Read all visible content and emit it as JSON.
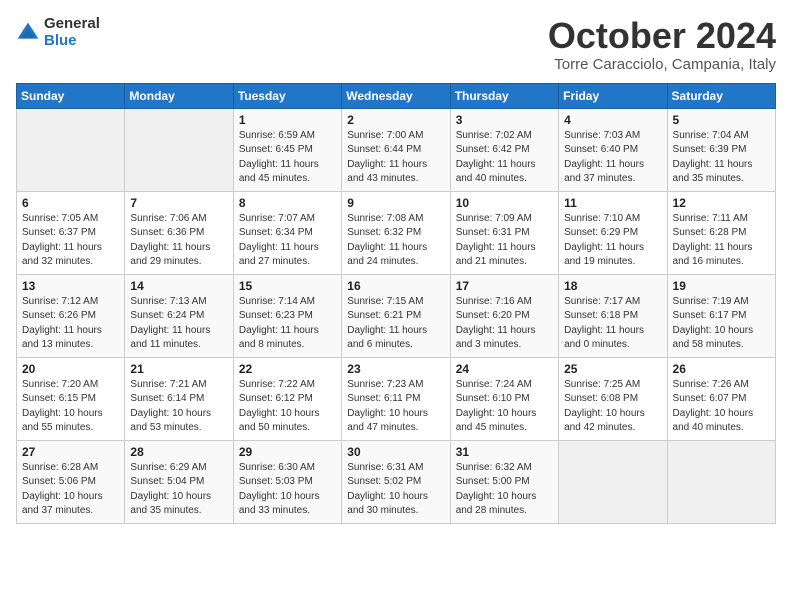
{
  "logo": {
    "general": "General",
    "blue": "Blue"
  },
  "title": "October 2024",
  "location": "Torre Caracciolo, Campania, Italy",
  "weekdays": [
    "Sunday",
    "Monday",
    "Tuesday",
    "Wednesday",
    "Thursday",
    "Friday",
    "Saturday"
  ],
  "weeks": [
    [
      {
        "day": "",
        "sunrise": "",
        "sunset": "",
        "daylight": ""
      },
      {
        "day": "",
        "sunrise": "",
        "sunset": "",
        "daylight": ""
      },
      {
        "day": "1",
        "sunrise": "Sunrise: 6:59 AM",
        "sunset": "Sunset: 6:45 PM",
        "daylight": "Daylight: 11 hours and 45 minutes."
      },
      {
        "day": "2",
        "sunrise": "Sunrise: 7:00 AM",
        "sunset": "Sunset: 6:44 PM",
        "daylight": "Daylight: 11 hours and 43 minutes."
      },
      {
        "day": "3",
        "sunrise": "Sunrise: 7:02 AM",
        "sunset": "Sunset: 6:42 PM",
        "daylight": "Daylight: 11 hours and 40 minutes."
      },
      {
        "day": "4",
        "sunrise": "Sunrise: 7:03 AM",
        "sunset": "Sunset: 6:40 PM",
        "daylight": "Daylight: 11 hours and 37 minutes."
      },
      {
        "day": "5",
        "sunrise": "Sunrise: 7:04 AM",
        "sunset": "Sunset: 6:39 PM",
        "daylight": "Daylight: 11 hours and 35 minutes."
      }
    ],
    [
      {
        "day": "6",
        "sunrise": "Sunrise: 7:05 AM",
        "sunset": "Sunset: 6:37 PM",
        "daylight": "Daylight: 11 hours and 32 minutes."
      },
      {
        "day": "7",
        "sunrise": "Sunrise: 7:06 AM",
        "sunset": "Sunset: 6:36 PM",
        "daylight": "Daylight: 11 hours and 29 minutes."
      },
      {
        "day": "8",
        "sunrise": "Sunrise: 7:07 AM",
        "sunset": "Sunset: 6:34 PM",
        "daylight": "Daylight: 11 hours and 27 minutes."
      },
      {
        "day": "9",
        "sunrise": "Sunrise: 7:08 AM",
        "sunset": "Sunset: 6:32 PM",
        "daylight": "Daylight: 11 hours and 24 minutes."
      },
      {
        "day": "10",
        "sunrise": "Sunrise: 7:09 AM",
        "sunset": "Sunset: 6:31 PM",
        "daylight": "Daylight: 11 hours and 21 minutes."
      },
      {
        "day": "11",
        "sunrise": "Sunrise: 7:10 AM",
        "sunset": "Sunset: 6:29 PM",
        "daylight": "Daylight: 11 hours and 19 minutes."
      },
      {
        "day": "12",
        "sunrise": "Sunrise: 7:11 AM",
        "sunset": "Sunset: 6:28 PM",
        "daylight": "Daylight: 11 hours and 16 minutes."
      }
    ],
    [
      {
        "day": "13",
        "sunrise": "Sunrise: 7:12 AM",
        "sunset": "Sunset: 6:26 PM",
        "daylight": "Daylight: 11 hours and 13 minutes."
      },
      {
        "day": "14",
        "sunrise": "Sunrise: 7:13 AM",
        "sunset": "Sunset: 6:24 PM",
        "daylight": "Daylight: 11 hours and 11 minutes."
      },
      {
        "day": "15",
        "sunrise": "Sunrise: 7:14 AM",
        "sunset": "Sunset: 6:23 PM",
        "daylight": "Daylight: 11 hours and 8 minutes."
      },
      {
        "day": "16",
        "sunrise": "Sunrise: 7:15 AM",
        "sunset": "Sunset: 6:21 PM",
        "daylight": "Daylight: 11 hours and 6 minutes."
      },
      {
        "day": "17",
        "sunrise": "Sunrise: 7:16 AM",
        "sunset": "Sunset: 6:20 PM",
        "daylight": "Daylight: 11 hours and 3 minutes."
      },
      {
        "day": "18",
        "sunrise": "Sunrise: 7:17 AM",
        "sunset": "Sunset: 6:18 PM",
        "daylight": "Daylight: 11 hours and 0 minutes."
      },
      {
        "day": "19",
        "sunrise": "Sunrise: 7:19 AM",
        "sunset": "Sunset: 6:17 PM",
        "daylight": "Daylight: 10 hours and 58 minutes."
      }
    ],
    [
      {
        "day": "20",
        "sunrise": "Sunrise: 7:20 AM",
        "sunset": "Sunset: 6:15 PM",
        "daylight": "Daylight: 10 hours and 55 minutes."
      },
      {
        "day": "21",
        "sunrise": "Sunrise: 7:21 AM",
        "sunset": "Sunset: 6:14 PM",
        "daylight": "Daylight: 10 hours and 53 minutes."
      },
      {
        "day": "22",
        "sunrise": "Sunrise: 7:22 AM",
        "sunset": "Sunset: 6:12 PM",
        "daylight": "Daylight: 10 hours and 50 minutes."
      },
      {
        "day": "23",
        "sunrise": "Sunrise: 7:23 AM",
        "sunset": "Sunset: 6:11 PM",
        "daylight": "Daylight: 10 hours and 47 minutes."
      },
      {
        "day": "24",
        "sunrise": "Sunrise: 7:24 AM",
        "sunset": "Sunset: 6:10 PM",
        "daylight": "Daylight: 10 hours and 45 minutes."
      },
      {
        "day": "25",
        "sunrise": "Sunrise: 7:25 AM",
        "sunset": "Sunset: 6:08 PM",
        "daylight": "Daylight: 10 hours and 42 minutes."
      },
      {
        "day": "26",
        "sunrise": "Sunrise: 7:26 AM",
        "sunset": "Sunset: 6:07 PM",
        "daylight": "Daylight: 10 hours and 40 minutes."
      }
    ],
    [
      {
        "day": "27",
        "sunrise": "Sunrise: 6:28 AM",
        "sunset": "Sunset: 5:06 PM",
        "daylight": "Daylight: 10 hours and 37 minutes."
      },
      {
        "day": "28",
        "sunrise": "Sunrise: 6:29 AM",
        "sunset": "Sunset: 5:04 PM",
        "daylight": "Daylight: 10 hours and 35 minutes."
      },
      {
        "day": "29",
        "sunrise": "Sunrise: 6:30 AM",
        "sunset": "Sunset: 5:03 PM",
        "daylight": "Daylight: 10 hours and 33 minutes."
      },
      {
        "day": "30",
        "sunrise": "Sunrise: 6:31 AM",
        "sunset": "Sunset: 5:02 PM",
        "daylight": "Daylight: 10 hours and 30 minutes."
      },
      {
        "day": "31",
        "sunrise": "Sunrise: 6:32 AM",
        "sunset": "Sunset: 5:00 PM",
        "daylight": "Daylight: 10 hours and 28 minutes."
      },
      {
        "day": "",
        "sunrise": "",
        "sunset": "",
        "daylight": ""
      },
      {
        "day": "",
        "sunrise": "",
        "sunset": "",
        "daylight": ""
      }
    ]
  ]
}
